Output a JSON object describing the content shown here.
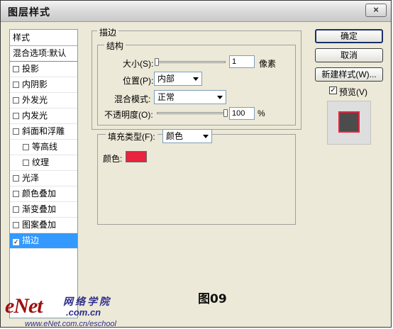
{
  "window": {
    "title": "图层样式",
    "close_symbol": "×"
  },
  "sidebar": {
    "header": "样式",
    "blend_options": "混合选项:默认",
    "items": [
      {
        "label": "投影",
        "checked": false,
        "sub": false
      },
      {
        "label": "内阴影",
        "checked": false,
        "sub": false
      },
      {
        "label": "外发光",
        "checked": false,
        "sub": false
      },
      {
        "label": "内发光",
        "checked": false,
        "sub": false
      },
      {
        "label": "斜面和浮雕",
        "checked": false,
        "sub": false
      },
      {
        "label": "等高线",
        "checked": false,
        "sub": true
      },
      {
        "label": "纹理",
        "checked": false,
        "sub": true
      },
      {
        "label": "光泽",
        "checked": false,
        "sub": false
      },
      {
        "label": "颜色叠加",
        "checked": false,
        "sub": false
      },
      {
        "label": "渐变叠加",
        "checked": false,
        "sub": false
      },
      {
        "label": "图案叠加",
        "checked": false,
        "sub": false
      },
      {
        "label": "描边",
        "checked": true,
        "sub": false,
        "selected": true
      }
    ],
    "check_mark": "✓"
  },
  "stroke": {
    "section_title": "描边",
    "structure_title": "结构",
    "size_label": "大小(S):",
    "size_value": "1",
    "size_unit": "像素",
    "size_fraction": 0.0,
    "position_label": "位置(P):",
    "position_value": "内部",
    "blend_label": "混合模式:",
    "blend_value": "正常",
    "opacity_label": "不透明度(O):",
    "opacity_value": "100",
    "opacity_unit": "%",
    "opacity_fraction": 1.0,
    "fill_type_label": "填充类型(F):",
    "fill_type_value": "颜色",
    "color_label": "颜色:",
    "color_hex": "#e8243f"
  },
  "buttons": {
    "ok": "确定",
    "cancel": "取消",
    "new_style": "新建样式(W)...",
    "preview_label": "预览(V)",
    "preview_checked": true
  },
  "preview": {
    "box_color": "#4c4c4c",
    "stroke_color": "#e8243f"
  },
  "caption": "图09",
  "watermark": {
    "brand": "eNet",
    "cn": "网络学院",
    "domain": ".com.cn",
    "url": "www.eNet.com.cn/eschool"
  }
}
